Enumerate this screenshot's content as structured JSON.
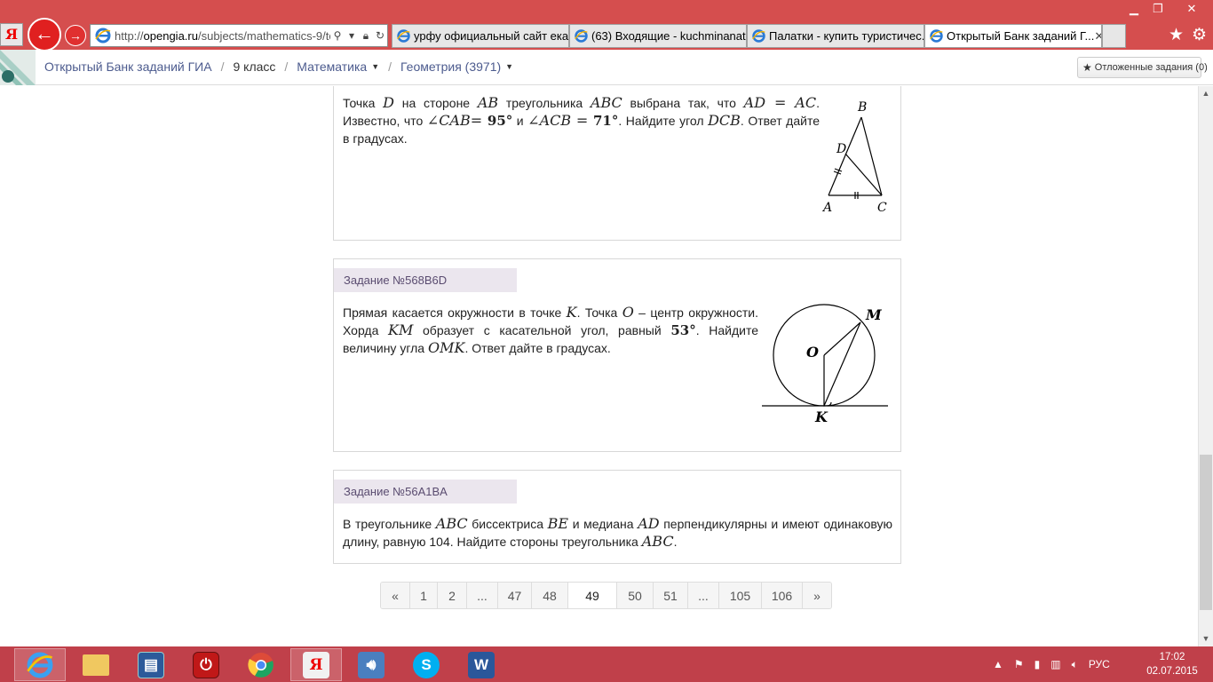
{
  "browser": {
    "yandex_glyph": "Я",
    "address_prefix": "http://",
    "address_host": "opengia.ru",
    "address_rest": "/subjects/mathematics-9/tc",
    "tabs": [
      {
        "label": "урфу официальный сайт екат..."
      },
      {
        "label": "(63) Входящие - kuchminanat..."
      },
      {
        "label": "Палатки - купить туристичес..."
      },
      {
        "label": "Открытый Банк заданий Г..."
      }
    ]
  },
  "site": {
    "breadcrumb": {
      "home": "Открытый Банк заданий ГИА",
      "grade": "9 класс",
      "subject": "Математика",
      "topic": "Геометрия (3971)"
    },
    "postponed": "Отложенные задания (0)"
  },
  "tasks": [
    {
      "text_parts": [
        "Точка ",
        "D",
        " на стороне ",
        "AB",
        " треугольника ",
        "ABC",
        " выбрана так, что ",
        "AD = AC",
        ". Известно, что ",
        "∠CAB",
        "= ",
        "95°",
        " и ",
        "∠ACB",
        " = ",
        "71°",
        ". Найдите угол ",
        "DCB",
        ". Ответ дайте в градусах."
      ],
      "figure_labels": {
        "a": "A",
        "b": "B",
        "c": "C",
        "d": "D"
      }
    },
    {
      "header": "Задание №568B6D",
      "text_parts": [
        "Прямая касается окружности в точке ",
        "K",
        ". Точка ",
        "O",
        " – центр окружности. Хорда ",
        "KM",
        " образует с касательной угол, равный ",
        "53°",
        ". Найдите величину угла ",
        "OMK",
        ". Ответ дайте в градусах."
      ],
      "figure_labels": {
        "o": "O",
        "m": "M",
        "k": "K"
      }
    },
    {
      "header": "Задание №56A1BA",
      "text_parts": [
        "В треугольнике ",
        "ABC",
        " биссектриса ",
        "BE",
        " и медиана ",
        "AD",
        " перпендикулярны и имеют одинаковую длину, равную 104. Найдите стороны треугольника ",
        "ABC",
        "."
      ]
    }
  ],
  "pagination": [
    "«",
    "1",
    "2",
    "...",
    "47",
    "48",
    "49",
    "50",
    "51",
    "...",
    "105",
    "106",
    "»"
  ],
  "pagination_current": "49",
  "taskbar": {
    "language": "РУС",
    "time": "17:02",
    "date": "02.07.2015"
  },
  "colors": {
    "browser_frame": "#d54e4e",
    "taskbar": "#c0404a",
    "task_header_bg": "#ebe6ee",
    "breadcrumb_link": "#4c5b8e"
  }
}
